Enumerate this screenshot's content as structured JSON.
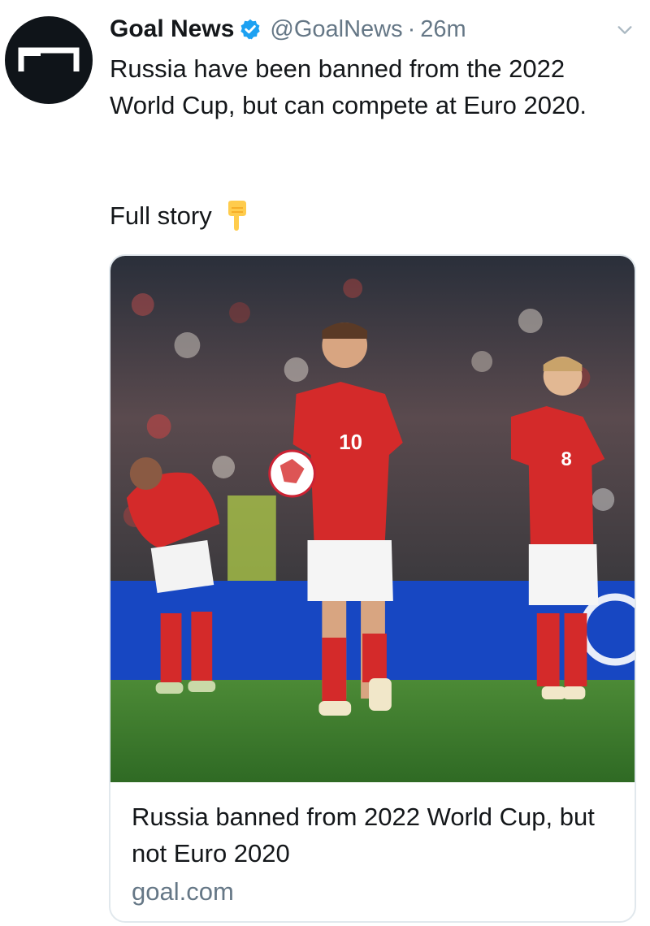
{
  "tweet": {
    "author_name": "Goal News",
    "handle": "@GoalNews",
    "separator": "·",
    "time": "26m",
    "text": "Russia have been banned from the 2022 World Cup, but can compete at Euro 2020.",
    "full_story": "Full story",
    "emoji_icon": "pointing-down-icon"
  },
  "card": {
    "title": "Russia banned from 2022 World Cup, but not Euro 2020",
    "domain": "goal.com",
    "jersey_numbers": [
      "10",
      "8"
    ]
  },
  "colors": {
    "verified": "#1da1f2",
    "secondary_text": "#657786",
    "kit_red": "#d42a2a",
    "pitch": "#3f7a2e",
    "board_blue": "#1747c2"
  }
}
